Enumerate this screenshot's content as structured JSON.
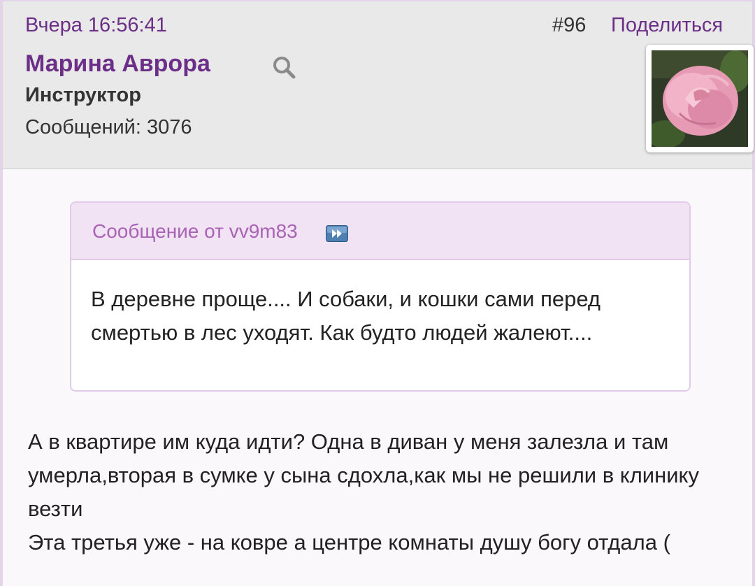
{
  "post": {
    "timestamp": "Вчера 16:56:41",
    "number": "#96",
    "share_label": "Поделиться",
    "author": {
      "name": "Марина Аврора",
      "role": "Инструктор",
      "message_count": "Сообщений: 3076",
      "avatar": "pink-rose-avatar"
    },
    "quote": {
      "header": "Сообщение от vv9m83",
      "text": "В деревне проще.... И собаки, и кошки сами перед смертью в лес уходят. Как будто людей жалеют...."
    },
    "body": [
      "А в квартире им куда идти? Одна в диван у  меня залезла и там умерла,вторая в сумке у сына сдохла,как мы не решили в клинику везти",
      "Эта третья уже - на ковре а центре комнаты душу богу отдала ("
    ]
  },
  "colors": {
    "accent": "#6b2f87",
    "quote_header_bg": "#f2e3f4",
    "quote_header_text": "#a963b4",
    "header_bg": "#e9e9e9"
  }
}
